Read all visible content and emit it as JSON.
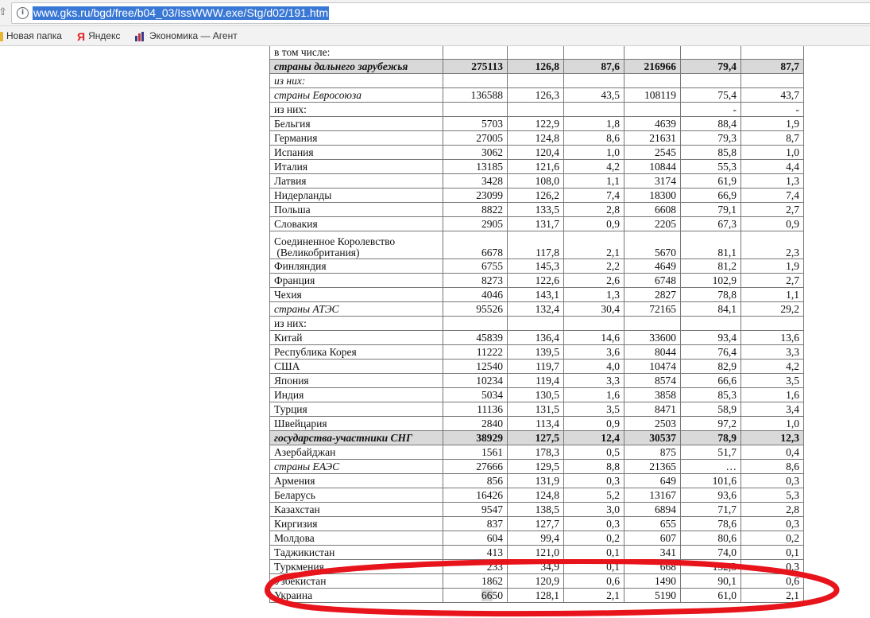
{
  "browser": {
    "url": "www.gks.ru/bgd/free/b04_03/IssWWW.exe/Stg/d02/191.htm",
    "bookmarks": [
      {
        "label": "Новая папка",
        "icon": "folder-icon"
      },
      {
        "label": "Яндекс",
        "icon": "yandex-icon"
      },
      {
        "label": "Экономика — Агент",
        "icon": "chart-icon"
      }
    ]
  },
  "table": {
    "rows": [
      {
        "name": "в том числе:",
        "style": "i0",
        "cells": [
          "",
          "",
          "",
          "",
          "",
          ""
        ]
      },
      {
        "name": "страны дальнего зарубежья",
        "style": "bold-it",
        "cells": [
          "275113",
          "126,8",
          "87,6",
          "216966",
          "79,4",
          "87,7"
        ]
      },
      {
        "name": "из них:",
        "style": "i2-it",
        "cells": [
          "",
          "",
          "",
          "",
          "",
          ""
        ]
      },
      {
        "name": "страны Евросоюза",
        "style": "i1-it",
        "cells": [
          "136588",
          "126,3",
          "43,5",
          "108119",
          "75,4",
          "43,7"
        ]
      },
      {
        "name": "из них:",
        "style": "i4",
        "cells": [
          "",
          "",
          "",
          "",
          "-",
          "-"
        ]
      },
      {
        "name": "Бельгия",
        "style": "i2",
        "cells": [
          "5703",
          "122,9",
          "1,8",
          "4639",
          "88,4",
          "1,9"
        ]
      },
      {
        "name": "Германия",
        "style": "i2",
        "cells": [
          "27005",
          "124,8",
          "8,6",
          "21631",
          "79,3",
          "8,7"
        ]
      },
      {
        "name": "Испания",
        "style": "i2",
        "cells": [
          "3062",
          "120,4",
          "1,0",
          "2545",
          "85,8",
          "1,0"
        ]
      },
      {
        "name": "Италия",
        "style": "i2",
        "cells": [
          "13185",
          "121,6",
          "4,2",
          "10844",
          "55,3",
          "4,4"
        ]
      },
      {
        "name": "Латвия",
        "style": "i2",
        "cells": [
          "3428",
          "108,0",
          "1,1",
          "3174",
          "61,9",
          "1,3"
        ]
      },
      {
        "name": "Нидерланды",
        "style": "i2",
        "cells": [
          "23099",
          "126,2",
          "7,4",
          "18300",
          "66,9",
          "7,4"
        ]
      },
      {
        "name": "Польша",
        "style": "i2",
        "cells": [
          "8822",
          "133,5",
          "2,8",
          "6608",
          "79,1",
          "2,7"
        ]
      },
      {
        "name": "Словакия",
        "style": "i2",
        "cells": [
          "2905",
          "131,7",
          "0,9",
          "2205",
          "67,3",
          "0,9"
        ]
      },
      {
        "name": "Соединенное Королевство",
        "name2": " (Великобритания)",
        "style": "i2-tall",
        "cells": [
          "6678",
          "117,8",
          "2,1",
          "5670",
          "81,1",
          "2,3"
        ]
      },
      {
        "name": "Финляндия",
        "style": "i2",
        "cells": [
          "6755",
          "145,3",
          "2,2",
          "4649",
          "81,2",
          "1,9"
        ]
      },
      {
        "name": "Франция",
        "style": "i2",
        "cells": [
          "8273",
          "122,6",
          "2,6",
          "6748",
          "102,9",
          "2,7"
        ]
      },
      {
        "name": "Чехия",
        "style": "i2",
        "cells": [
          "4046",
          "143,1",
          "1,3",
          "2827",
          "78,8",
          "1,1"
        ]
      },
      {
        "name": "страны АТЭС",
        "style": "i1-it",
        "cells": [
          "95526",
          "132,4",
          "30,4",
          "72165",
          "84,1",
          "29,2"
        ]
      },
      {
        "name": "из них:",
        "style": "i3",
        "cells": [
          "",
          "",
          "",
          "",
          "",
          ""
        ]
      },
      {
        "name": "Китай",
        "style": "i4",
        "cells": [
          "45839",
          "136,4",
          "14,6",
          "33600",
          "93,4",
          "13,6"
        ]
      },
      {
        "name": "Республика Корея",
        "style": "i4",
        "cells": [
          "11222",
          "139,5",
          "3,6",
          "8044",
          "76,4",
          "3,3"
        ]
      },
      {
        "name": "США",
        "style": "i4",
        "cells": [
          "12540",
          "119,7",
          "4,0",
          "10474",
          "82,9",
          "4,2"
        ]
      },
      {
        "name": "Япония",
        "style": "i4",
        "cells": [
          "10234",
          "119,4",
          "3,3",
          "8574",
          "66,6",
          "3,5"
        ]
      },
      {
        "name": "Индия",
        "style": "i1",
        "cells": [
          "5034",
          "130,5",
          "1,6",
          "3858",
          "85,3",
          "1,6"
        ]
      },
      {
        "name": "Турция",
        "style": "i1",
        "cells": [
          "11136",
          "131,5",
          "3,5",
          "8471",
          "58,9",
          "3,4"
        ]
      },
      {
        "name": "Швейцария",
        "style": "i1",
        "cells": [
          "2840",
          "113,4",
          "0,9",
          "2503",
          "97,2",
          "1,0"
        ]
      },
      {
        "name": "государства-участники СНГ",
        "style": "bold-it",
        "cells": [
          "38929",
          "127,5",
          "12,4",
          "30537",
          "78,9",
          "12,3"
        ]
      },
      {
        "name": "Азербайджан",
        "style": "i1",
        "cells": [
          "1561",
          "178,3",
          "0,5",
          "875",
          "51,7",
          "0,4"
        ]
      },
      {
        "name": "страны ЕАЭС",
        "style": "i1-it",
        "cells": [
          "27666",
          "129,5",
          "8,8",
          "21365",
          "…",
          "8,6"
        ]
      },
      {
        "name": "Армения",
        "style": "i2",
        "cells": [
          "856",
          "131,9",
          "0,3",
          "649",
          "101,6",
          "0,3"
        ]
      },
      {
        "name": "Беларусь",
        "style": "i2",
        "cells": [
          "16426",
          "124,8",
          "5,2",
          "13167",
          "93,6",
          "5,3"
        ]
      },
      {
        "name": "Казахстан",
        "style": "i2",
        "cells": [
          "9547",
          "138,5",
          "3,0",
          "6894",
          "71,7",
          "2,8"
        ]
      },
      {
        "name": "Киргизия",
        "style": "i2",
        "cells": [
          "837",
          "127,7",
          "0,3",
          "655",
          "78,6",
          "0,3"
        ]
      },
      {
        "name": "Молдова",
        "style": "i1",
        "cells": [
          "604",
          "99,4",
          "0,2",
          "607",
          "80,6",
          "0,2"
        ]
      },
      {
        "name": "Таджикистан",
        "style": "i1",
        "cells": [
          "413",
          "121,0",
          "0,1",
          "341",
          "74,0",
          "0,1"
        ]
      },
      {
        "name": "Туркмения",
        "style": "i1",
        "cells": [
          "233",
          "34,9",
          "0,1",
          "668",
          "132,3",
          "0,3"
        ]
      },
      {
        "name": "Узбекистан",
        "style": "i1",
        "cells": [
          "1862",
          "120,9",
          "0,6",
          "1490",
          "90,1",
          "0,6"
        ]
      },
      {
        "name": "Украина",
        "style": "i1",
        "cells": [
          "6650",
          "128,1",
          "2,1",
          "5190",
          "61,0",
          "2,1"
        ]
      }
    ]
  },
  "annotation": {
    "color": "#e8141c"
  }
}
